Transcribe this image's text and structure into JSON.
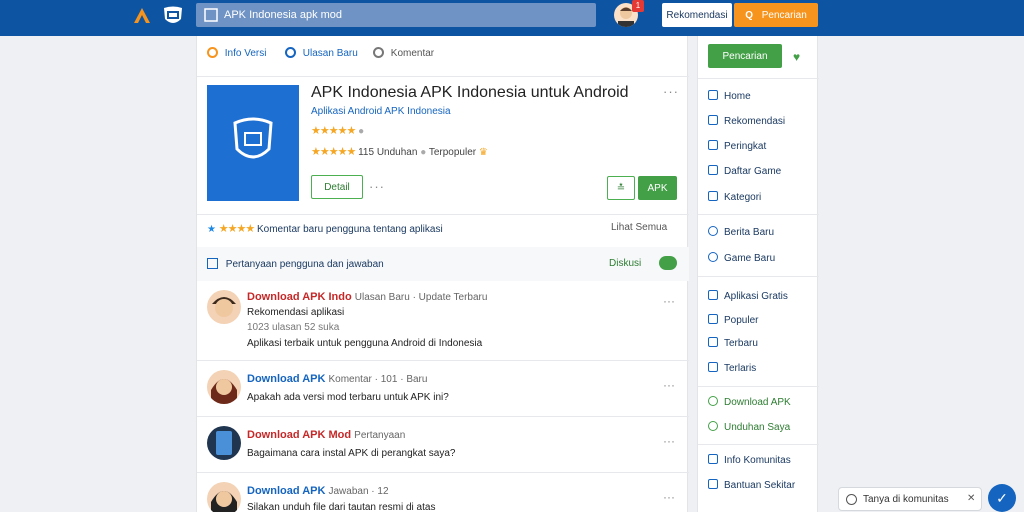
{
  "header": {
    "search_value": "APK Indonesia apk mod",
    "search_placeholder": "APK Indonesia apk mod",
    "notification_count": "1",
    "button_secondary": "Rekomendasi",
    "button_primary": "Pencarian"
  },
  "tabs": [
    {
      "label": "Info Versi"
    },
    {
      "label": "Ulasan Baru"
    },
    {
      "label": "Komentar"
    }
  ],
  "app": {
    "title": "APK Indonesia APK Indonesia untuk Android",
    "subtitle": "Aplikasi Android APK Indonesia",
    "rating_stars": "★★★★★",
    "rating2_text": "115 Unduhan",
    "rating2_extra": "Terpopuler",
    "button_outline": "Detail",
    "button_green": "APK",
    "button_small_icon": "≛"
  },
  "rating_bar": {
    "label": "Komentar baru pengguna tentang aplikasi",
    "right": "Lihat Semua"
  },
  "info_bar": {
    "label": "Pertanyaan pengguna dan jawaban",
    "right": "Diskusi"
  },
  "posts": [
    {
      "name": "Download APK Indo",
      "meta": "Ulasan Baru · Update Terbaru",
      "line2": "Rekomendasi aplikasi",
      "line3": "1023 ulasan 52 suka",
      "text": "Aplikasi terbaik untuk pengguna Android di Indonesia",
      "name_color": "#c62828"
    },
    {
      "name": "Download APK",
      "meta": "Komentar · 101 · Baru",
      "text": "Apakah ada versi mod terbaru untuk APK ini?",
      "name_color": "#1565c0"
    },
    {
      "name": "Download APK Mod",
      "meta": "Pertanyaan",
      "text": "Bagaimana cara instal APK di perangkat saya?",
      "name_color": "#c62828"
    },
    {
      "name": "Download APK",
      "meta": "Jawaban · 12",
      "text": "Silakan unduh file dari tautan resmi di atas",
      "name_color": "#1565c0"
    }
  ],
  "sidebar": {
    "top_button": "Pencarian",
    "items": [
      {
        "label": "Home"
      },
      {
        "label": "Rekomendasi"
      },
      {
        "label": "Peringkat"
      },
      {
        "label": "Daftar Game"
      },
      {
        "label": "Kategori"
      },
      {
        "label": "Berita Baru"
      },
      {
        "label": "Game Baru"
      },
      {
        "label": "Aplikasi Gratis"
      },
      {
        "label": "Populer"
      },
      {
        "label": "Terbaru"
      },
      {
        "label": "Terlaris"
      },
      {
        "label": "Download APK"
      },
      {
        "label": "Unduhan Saya"
      },
      {
        "label": "Info Komunitas"
      },
      {
        "label": "Bantuan Sekitar"
      }
    ]
  },
  "chat": {
    "text": "Tanya di komunitas",
    "close": "✕"
  },
  "colors": {
    "topbar": "#0d55a3",
    "accent_orange": "#f7941d",
    "accent_green": "#43a047",
    "link_blue": "#1565c0"
  }
}
